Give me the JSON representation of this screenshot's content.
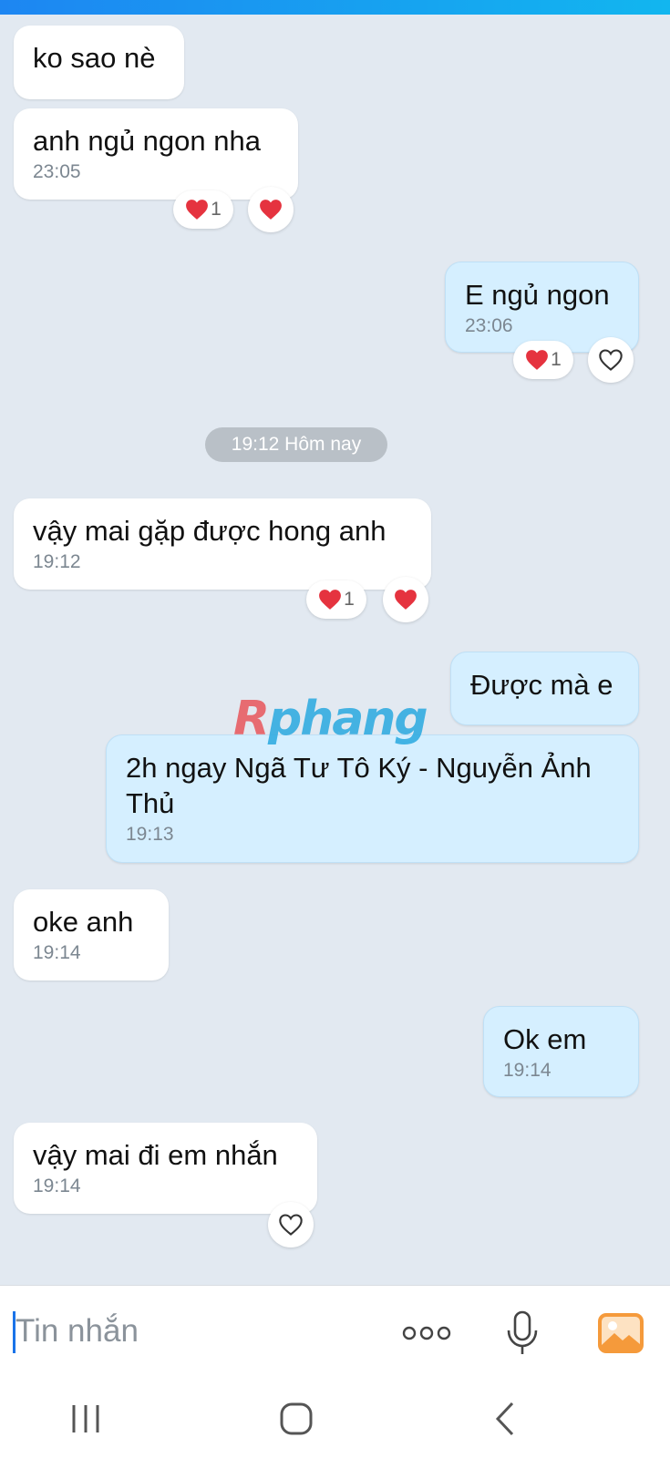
{
  "watermark": {
    "brand_first": "R",
    "brand_rest": "phang"
  },
  "messages": [
    {
      "text": "ko sao nè",
      "time": ""
    },
    {
      "text": "anh ngủ ngon nha",
      "time": "23:05",
      "reaction_count": "1"
    },
    {
      "text": "E ngủ ngon",
      "time": "23:06",
      "reaction_count": "1"
    },
    {
      "text": "vậy mai gặp được hong anh",
      "time": "19:12",
      "reaction_count": "1"
    },
    {
      "text": "Được mà e",
      "time": ""
    },
    {
      "text": "2h ngay Ngã Tư Tô Ký - Nguyễn Ảnh Thủ",
      "time": "19:13"
    },
    {
      "text": "oke anh",
      "time": "19:14"
    },
    {
      "text": "Ok em",
      "time": "19:14"
    },
    {
      "text": "vậy mai đi em nhắn",
      "time": "19:14"
    }
  ],
  "date_separator": "19:12 Hôm nay",
  "composer": {
    "placeholder": "Tin nhắn",
    "icons": [
      "more-icon",
      "microphone-icon",
      "image-icon"
    ]
  },
  "navigation": {
    "icons": [
      "recent-apps-icon",
      "home-icon",
      "back-icon"
    ]
  },
  "colors": {
    "background": "#e2e9f1",
    "received_bubble": "#ffffff",
    "sent_bubble": "#d5efff",
    "heart": "#e5333f",
    "image_icon": "#f59a3b"
  }
}
